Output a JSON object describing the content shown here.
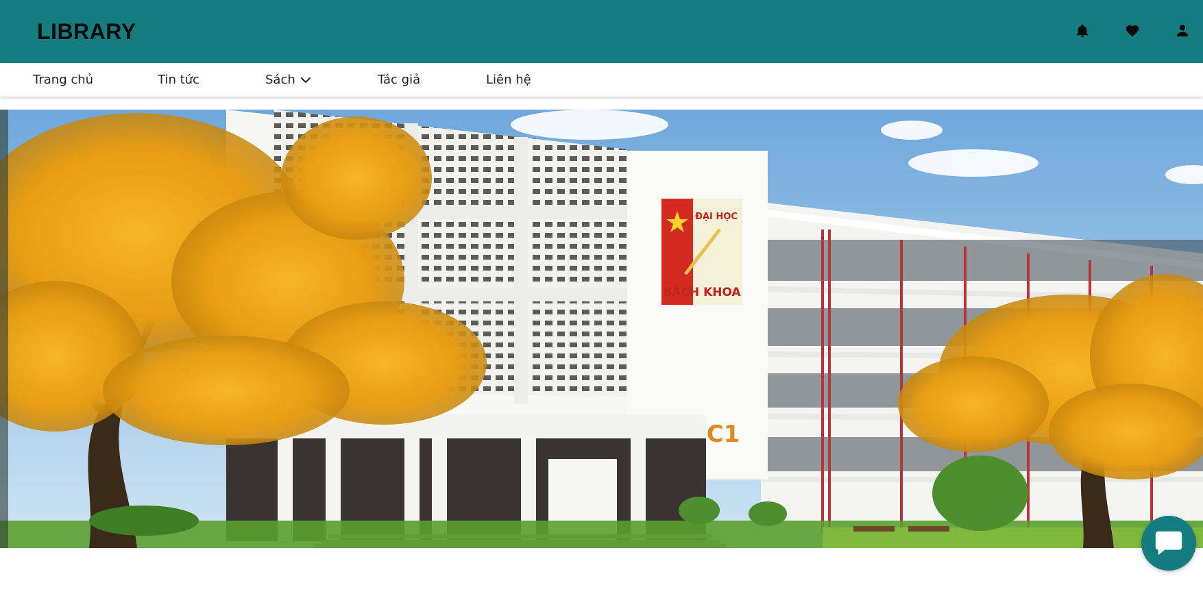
{
  "header": {
    "logo_text": "LIBRARY",
    "bg_color": "#157d80",
    "icons": [
      "bell-icon",
      "heart-icon",
      "user-icon"
    ]
  },
  "nav": {
    "items": [
      {
        "label": "Trang chủ"
      },
      {
        "label": "Tin tức"
      },
      {
        "label": "Sách",
        "icon": "chevron-down-icon"
      },
      {
        "label": "Tác giả"
      },
      {
        "label": "Liên hệ"
      }
    ]
  },
  "banner": {
    "description_icon": "campus-photo",
    "sign_line1": "ĐẠI HỌC",
    "sign_line2": "BÁCH KHOA",
    "building_label": "C1"
  },
  "chat": {
    "icon": "chat-bubble-icon",
    "color": "#157d80"
  }
}
